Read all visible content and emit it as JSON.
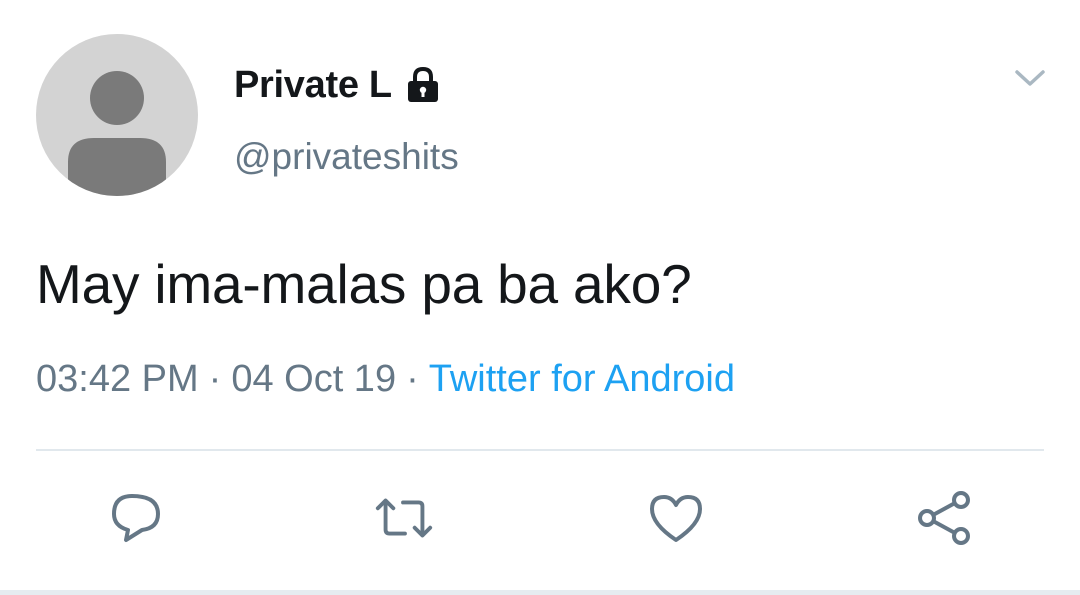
{
  "user": {
    "display_name": "Private L",
    "handle": "@privateshits",
    "protected": true
  },
  "tweet": {
    "text": "May ima-malas pa ba ako?",
    "time": "03:42 PM",
    "date": "04 Oct 19",
    "source": "Twitter for Android",
    "separator": "·"
  },
  "actions": [
    "reply-icon",
    "retweet-icon",
    "like-icon",
    "share-icon"
  ],
  "colors": {
    "text": "#14171a",
    "secondary": "#657786",
    "link": "#1da1f2",
    "divider": "#e1e8ed"
  }
}
